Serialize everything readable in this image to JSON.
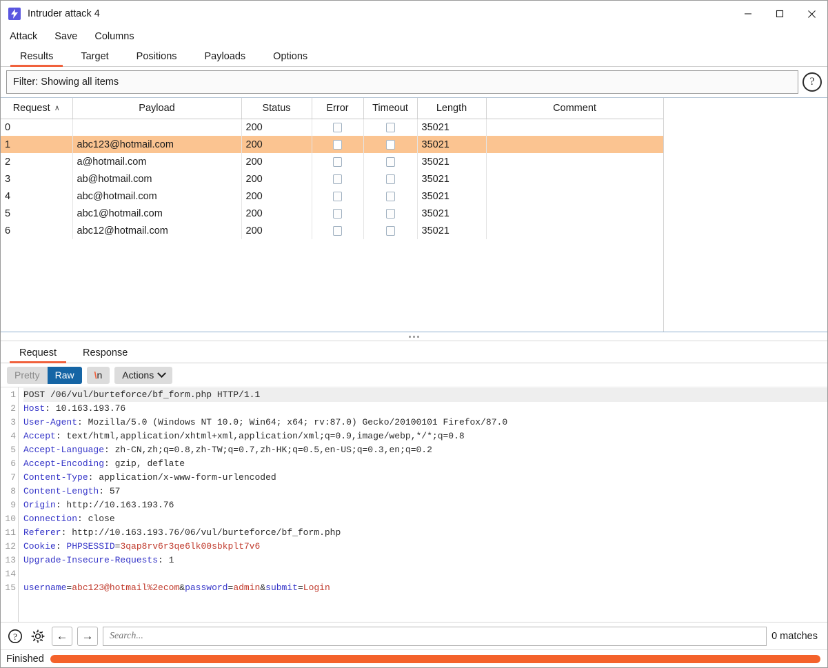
{
  "window": {
    "title": "Intruder attack 4",
    "icon": "burp-lightning-icon",
    "minimize_label": "Minimize",
    "maximize_label": "Maximize",
    "close_label": "Close"
  },
  "menubar": {
    "items": [
      {
        "label": "Attack",
        "name": "menu-attack"
      },
      {
        "label": "Save",
        "name": "menu-save"
      },
      {
        "label": "Columns",
        "name": "menu-columns"
      }
    ]
  },
  "tabs": {
    "items": [
      {
        "label": "Results",
        "active": true
      },
      {
        "label": "Target",
        "active": false
      },
      {
        "label": "Positions",
        "active": false
      },
      {
        "label": "Payloads",
        "active": false
      },
      {
        "label": "Options",
        "active": false
      }
    ]
  },
  "filter": {
    "text": "Filter: Showing all items",
    "help_glyph": "?"
  },
  "results_table": {
    "columns": [
      {
        "label": "Request",
        "sort": "asc",
        "sort_glyph": "∧"
      },
      {
        "label": "Payload"
      },
      {
        "label": "Status"
      },
      {
        "label": "Error"
      },
      {
        "label": "Timeout"
      },
      {
        "label": "Length"
      },
      {
        "label": "Comment"
      }
    ],
    "rows": [
      {
        "request": "0",
        "payload": "",
        "status": "200",
        "error": false,
        "timeout": false,
        "length": "35021",
        "comment": "",
        "selected": false
      },
      {
        "request": "1",
        "payload": "abc123@hotmail.com",
        "status": "200",
        "error": false,
        "timeout": false,
        "length": "35021",
        "comment": "",
        "selected": true
      },
      {
        "request": "2",
        "payload": "a@hotmail.com",
        "status": "200",
        "error": false,
        "timeout": false,
        "length": "35021",
        "comment": "",
        "selected": false
      },
      {
        "request": "3",
        "payload": "ab@hotmail.com",
        "status": "200",
        "error": false,
        "timeout": false,
        "length": "35021",
        "comment": "",
        "selected": false
      },
      {
        "request": "4",
        "payload": "abc@hotmail.com",
        "status": "200",
        "error": false,
        "timeout": false,
        "length": "35021",
        "comment": "",
        "selected": false
      },
      {
        "request": "5",
        "payload": "abc1@hotmail.com",
        "status": "200",
        "error": false,
        "timeout": false,
        "length": "35021",
        "comment": "",
        "selected": false
      },
      {
        "request": "6",
        "payload": "abc12@hotmail.com",
        "status": "200",
        "error": false,
        "timeout": false,
        "length": "35021",
        "comment": "",
        "selected": false
      }
    ]
  },
  "message_tabs": {
    "items": [
      {
        "label": "Request",
        "active": true
      },
      {
        "label": "Response",
        "active": false
      }
    ]
  },
  "editor_toolbar": {
    "pretty_label": "Pretty",
    "raw_label": "Raw",
    "newline_label": "\\n",
    "newline_backslash": "\\",
    "newline_n": "n",
    "actions_label": "Actions"
  },
  "request_body": {
    "lines": [
      {
        "n": "1",
        "highlight": true,
        "segments": [
          {
            "t": "POST /06/vul/burteforce/bf_form.php HTTP/1.1",
            "c": "val"
          }
        ]
      },
      {
        "n": "2",
        "highlight": false,
        "segments": [
          {
            "t": "Host",
            "c": "hdr"
          },
          {
            "t": ": 10.163.193.76",
            "c": "val"
          }
        ]
      },
      {
        "n": "3",
        "highlight": false,
        "segments": [
          {
            "t": "User-Agent",
            "c": "hdr"
          },
          {
            "t": ": Mozilla/5.0 (Windows NT 10.0; Win64; x64; rv:87.0) Gecko/20100101 Firefox/87.0",
            "c": "val"
          }
        ]
      },
      {
        "n": "4",
        "highlight": false,
        "segments": [
          {
            "t": "Accept",
            "c": "hdr"
          },
          {
            "t": ": text/html,application/xhtml+xml,application/xml;q=0.9,image/webp,*/*;q=0.8",
            "c": "val"
          }
        ]
      },
      {
        "n": "5",
        "highlight": false,
        "segments": [
          {
            "t": "Accept-Language",
            "c": "hdr"
          },
          {
            "t": ": zh-CN,zh;q=0.8,zh-TW;q=0.7,zh-HK;q=0.5,en-US;q=0.3,en;q=0.2",
            "c": "val"
          }
        ]
      },
      {
        "n": "6",
        "highlight": false,
        "segments": [
          {
            "t": "Accept-Encoding",
            "c": "hdr"
          },
          {
            "t": ": gzip, deflate",
            "c": "val"
          }
        ]
      },
      {
        "n": "7",
        "highlight": false,
        "segments": [
          {
            "t": "Content-Type",
            "c": "hdr"
          },
          {
            "t": ": application/x-www-form-urlencoded",
            "c": "val"
          }
        ]
      },
      {
        "n": "8",
        "highlight": false,
        "segments": [
          {
            "t": "Content-Length",
            "c": "hdr"
          },
          {
            "t": ": 57",
            "c": "val"
          }
        ]
      },
      {
        "n": "9",
        "highlight": false,
        "segments": [
          {
            "t": "Origin",
            "c": "hdr"
          },
          {
            "t": ": http://10.163.193.76",
            "c": "val"
          }
        ]
      },
      {
        "n": "10",
        "highlight": false,
        "segments": [
          {
            "t": "Connection",
            "c": "hdr"
          },
          {
            "t": ": close",
            "c": "val"
          }
        ]
      },
      {
        "n": "11",
        "highlight": false,
        "segments": [
          {
            "t": "Referer",
            "c": "hdr"
          },
          {
            "t": ": http://10.163.193.76/06/vul/burteforce/bf_form.php",
            "c": "val"
          }
        ]
      },
      {
        "n": "12",
        "highlight": false,
        "segments": [
          {
            "t": "Cookie",
            "c": "hdr"
          },
          {
            "t": ": ",
            "c": "val"
          },
          {
            "t": "PHPSESSID",
            "c": "blue"
          },
          {
            "t": "=",
            "c": "val"
          },
          {
            "t": "3qap8rv6r3qe6lk00sbkplt7v6",
            "c": "red"
          }
        ]
      },
      {
        "n": "13",
        "highlight": false,
        "segments": [
          {
            "t": "Upgrade-Insecure-Requests",
            "c": "hdr"
          },
          {
            "t": ": 1",
            "c": "val"
          }
        ]
      },
      {
        "n": "14",
        "highlight": false,
        "segments": [
          {
            "t": "",
            "c": "val"
          }
        ]
      },
      {
        "n": "15",
        "highlight": false,
        "segments": [
          {
            "t": "username",
            "c": "blue"
          },
          {
            "t": "=",
            "c": "val"
          },
          {
            "t": "abc123@hotmail%2ecom",
            "c": "red"
          },
          {
            "t": "&",
            "c": "val"
          },
          {
            "t": "password",
            "c": "blue"
          },
          {
            "t": "=",
            "c": "val"
          },
          {
            "t": "admin",
            "c": "red"
          },
          {
            "t": "&",
            "c": "val"
          },
          {
            "t": "submit",
            "c": "blue"
          },
          {
            "t": "=",
            "c": "val"
          },
          {
            "t": "Login",
            "c": "red"
          }
        ]
      }
    ]
  },
  "search_bar": {
    "help_glyph": "?",
    "settings_icon": "gear-icon",
    "prev_glyph": "←",
    "next_glyph": "→",
    "placeholder": "Search...",
    "value": "",
    "matches": "0 matches"
  },
  "status_bar": {
    "text": "Finished",
    "progress_percent": 100,
    "progress_color": "#f4622b"
  },
  "theme": {
    "accent": "#f0613c",
    "selection": "#fbc491",
    "raw_button": "#1565a5",
    "app_icon_bg": "#5a56e0"
  }
}
